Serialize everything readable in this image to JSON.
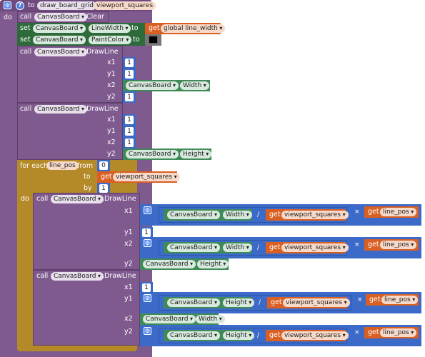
{
  "header": {
    "to": "to",
    "proc_name": "draw_board_grid",
    "param": "viewport_squares"
  },
  "do": "do",
  "call": "call",
  "set": "set",
  "to": "to",
  "get": "get",
  "canvas": "CanvasBoard",
  "clear": ".Clear",
  "drawline": ".DrawLine",
  "linewidth": "LineWidth",
  "paintcolor": "PaintColor",
  "global_line_width": "global line_width",
  "x1": "x1",
  "y1": "y1",
  "x2": "x2",
  "y2": "y2",
  "width": "Width",
  "height": "Height",
  "one": "1",
  "zero": "0",
  "foreach": "for each",
  "line_pos": "line_pos",
  "from": "from",
  "by": "by",
  "viewport_squares": "viewport_squares",
  "slash": "/",
  "times": "×",
  "colors": {
    "proc": "#7f5a8f",
    "setter": "#2e6b3a",
    "getter": "#3f8a58",
    "var": "#d95f23",
    "math": "#3c6ac8",
    "loop": "#b38a27",
    "paint": "#000000"
  }
}
